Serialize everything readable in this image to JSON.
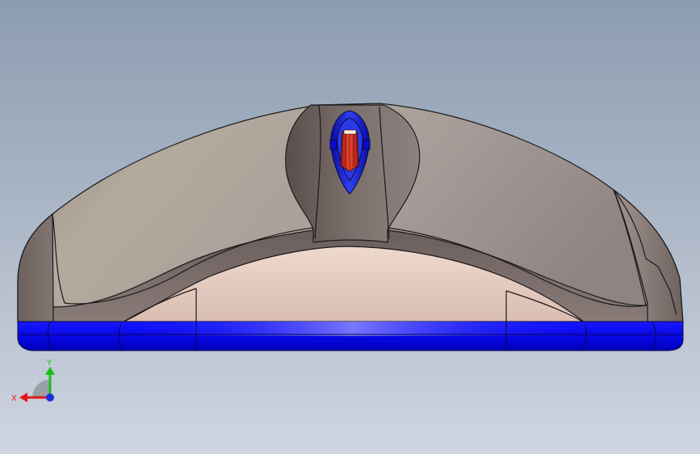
{
  "viewport": {
    "background_top": "#8c9cb0",
    "background_bottom": "#cfd5e0"
  },
  "model": {
    "body_color": "#b8aca6",
    "body_shadow": "#7a6e6a",
    "skirt_color": "#0a0aff",
    "skirt_dark": "#0000c8",
    "wheel_color": "#e03020",
    "wheel_housing_color": "#1a2ad8",
    "edge_color": "#1a1a1a",
    "front_face_color": "#e2c4b8"
  },
  "triad": {
    "x_label": "X",
    "y_label": "Y",
    "x_color": "#e01818",
    "y_color": "#18c018",
    "z_color": "#1830e0"
  }
}
